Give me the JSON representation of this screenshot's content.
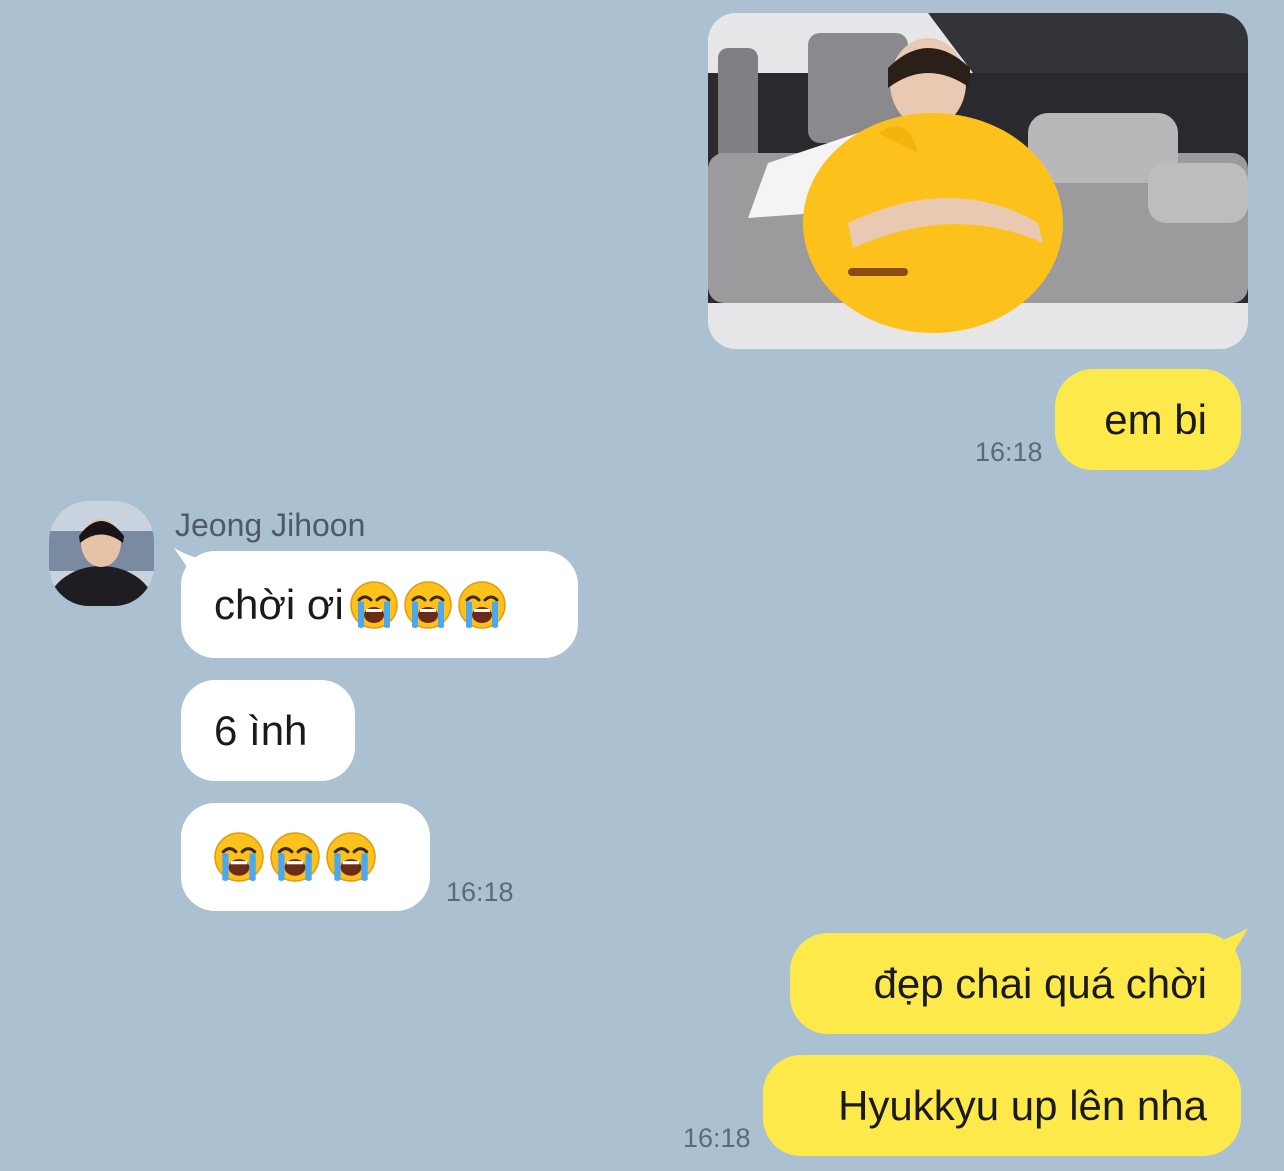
{
  "contact": {
    "name": "Jeong Jihoon",
    "avatar_icon": "profile-photo"
  },
  "colors": {
    "background": "#abc1d1",
    "outgoing_bubble": "#fee94b",
    "incoming_bubble": "#ffffff"
  },
  "messages": {
    "m1": {
      "text": "em bi",
      "time": "16:18"
    },
    "m2": {
      "text": "chời ơi",
      "emoji": "loudly-crying-face"
    },
    "m3": {
      "text": "6 ình"
    },
    "m4": {
      "emoji": "loudly-crying-face",
      "time": "16:18"
    },
    "m5": {
      "text": "đẹp chai quá chời"
    },
    "m6": {
      "text": "Hyukkyu up lên nha",
      "time": "16:18"
    }
  }
}
